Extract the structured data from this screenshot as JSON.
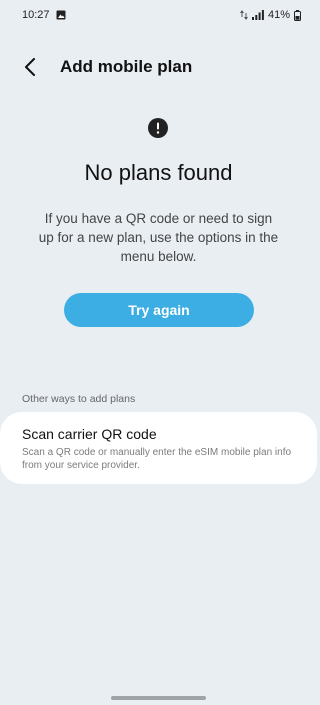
{
  "status_bar": {
    "time": "10:27",
    "battery_percent": "41%",
    "icons": [
      "image-icon",
      "data-icon",
      "signal-icon",
      "battery-icon"
    ]
  },
  "header": {
    "title": "Add mobile plan",
    "back_icon": "back-arrow-icon"
  },
  "main": {
    "alert_icon": "exclamation-circle-icon",
    "headline": "No plans found",
    "description": "If you have a QR code or need to sign up for a new plan, use the options in the menu below.",
    "try_again_label": "Try again",
    "accent_color": "#3caee3"
  },
  "other_ways": {
    "section_label": "Other ways to add plans",
    "items": [
      {
        "title": "Scan carrier QR code",
        "subtitle": "Scan a QR code or manually enter the eSIM mobile plan info from your service provider."
      }
    ]
  }
}
